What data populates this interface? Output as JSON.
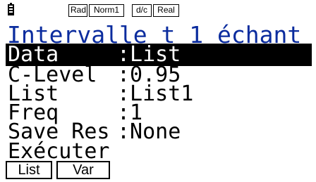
{
  "status_bar": {
    "battery": "battery-icon",
    "angle": "Rad",
    "display": "Norm1",
    "fraction": "d/c",
    "complex": "Real"
  },
  "title": "Intervalle t 1 échant",
  "fields": [
    {
      "key": "Data",
      "value": ":List",
      "selected": true
    },
    {
      "key": "C-Level",
      "value": ":0.95",
      "selected": false
    },
    {
      "key": "List",
      "value": ":List1",
      "selected": false
    },
    {
      "key": "Freq",
      "value": ":1",
      "selected": false
    },
    {
      "key": "Save Res",
      "value": ":None",
      "selected": false
    }
  ],
  "execute_label": "Exécuter",
  "function_keys": [
    {
      "label": "List"
    },
    {
      "label": "Var"
    }
  ],
  "colors": {
    "title": "#0b2c9e",
    "highlight_bg": "#000000",
    "highlight_fg": "#ffffff"
  }
}
